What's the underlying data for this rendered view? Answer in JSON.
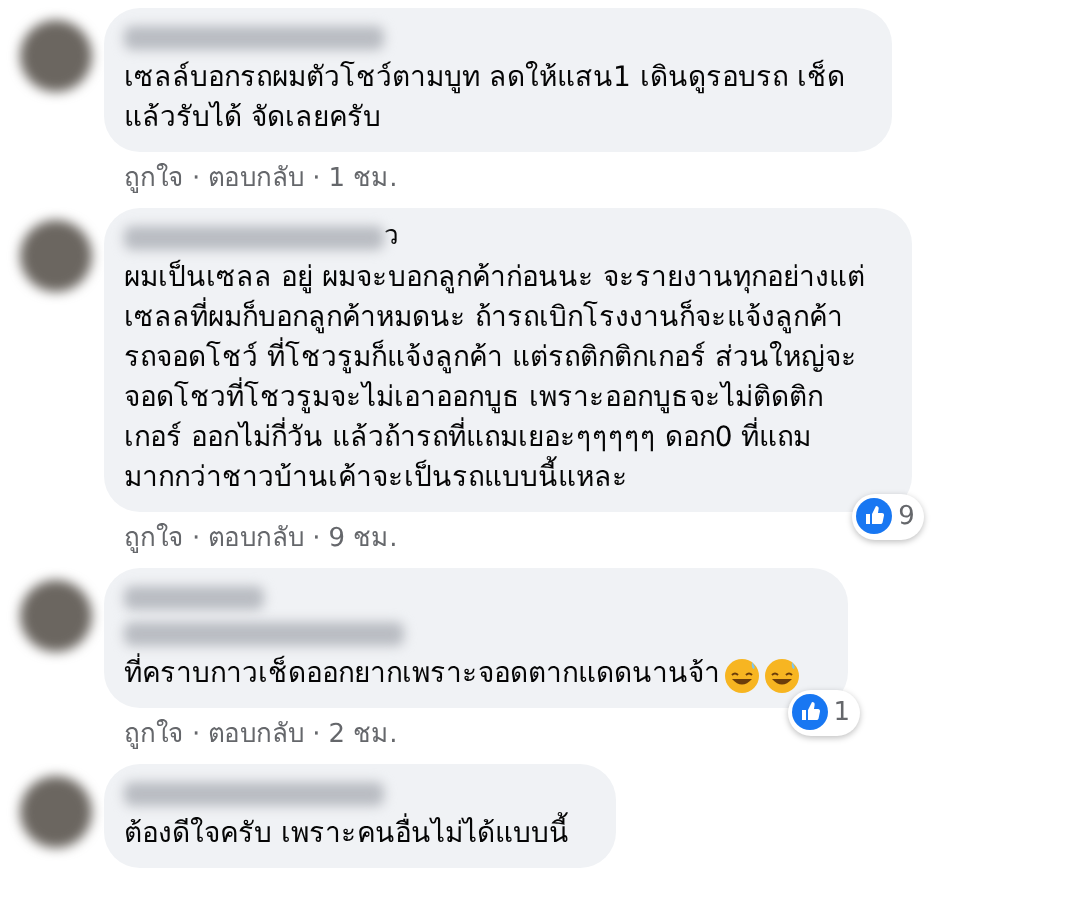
{
  "comments": [
    {
      "kind": "single_name",
      "lines": [
        "เซลล์บอกรถผมตัวโชว์ตามบูท ลดให้แสน1 เดินดูรอบรถ เช็ด",
        "แล้วรับได้ จัดเลยครับ"
      ],
      "actions": {
        "like": "ถูกใจ",
        "reply": "ตอบกลับ",
        "time": "1 ชม.",
        "dot": "·"
      }
    },
    {
      "kind": "single_name",
      "name_tail": "ว",
      "lines": [
        "ผมเป็นเซลล อยู่ ผมจะบอกลูกค้าก่อนนะ จะรายงานทุกอย่างแต่",
        "เซลลที่ผมก็บอกลูกค้าหมดนะ ถ้ารถเบิกโรงงานก็จะแจ้งลูกค้า",
        "รถจอดโชว์ ที่โชวรูมก็แจ้งลูกค้า แต่รถติกติกเกอร์ ส่วนใหญ่จะ",
        "จอดโชวที่โชวรูมจะไม่เอาออกบูธ เพราะออกบูธจะไม่ติดติก",
        "เกอร์ ออกไม่กี่วัน แล้วถ้ารถที่แถมเยอะๆๆๆๆๆ ดอก0 ที่แถม",
        "มากกว่าชาวบ้านเค้าจะเป็นรถแบบนี้แหละ"
      ],
      "actions": {
        "like": "ถูกใจ",
        "reply": "ตอบกลับ",
        "time": "9 ชม.",
        "dot": "·"
      },
      "reaction": {
        "count": "9"
      }
    },
    {
      "kind": "double_name",
      "lines": [
        "ที่คราบกาวเช็ดออกยากเพราะจอดตากแดดนานจ้า"
      ],
      "emoji": [
        {
          "kind": "grin_sweat"
        },
        {
          "kind": "grin_sweat"
        }
      ],
      "actions": {
        "like": "ถูกใจ",
        "reply": "ตอบกลับ",
        "time": "2 ชม.",
        "dot": "·"
      },
      "reaction": {
        "count": "1"
      }
    },
    {
      "kind": "single_name",
      "lines": [
        "ต้องดีใจครับ เพราะคนอื่นไม่ได้แบบนี้"
      ]
    }
  ]
}
